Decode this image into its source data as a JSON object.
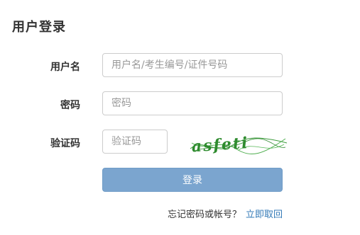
{
  "header": {
    "title": "用户登录"
  },
  "form": {
    "username": {
      "label": "用户名",
      "placeholder": "用户名/考生编号/证件号码",
      "value": ""
    },
    "password": {
      "label": "密码",
      "placeholder": "密码",
      "value": ""
    },
    "captcha": {
      "label": "验证码",
      "placeholder": "验证码",
      "value": "",
      "image_text": "asfeti",
      "image_color": "#2e8b2e"
    },
    "submit_label": "登录",
    "submit_color": "#7ba5cf"
  },
  "footer": {
    "forgot_text": "忘记密码或帐号？",
    "recover_link": "立即取回",
    "link_color": "#337ab7"
  }
}
